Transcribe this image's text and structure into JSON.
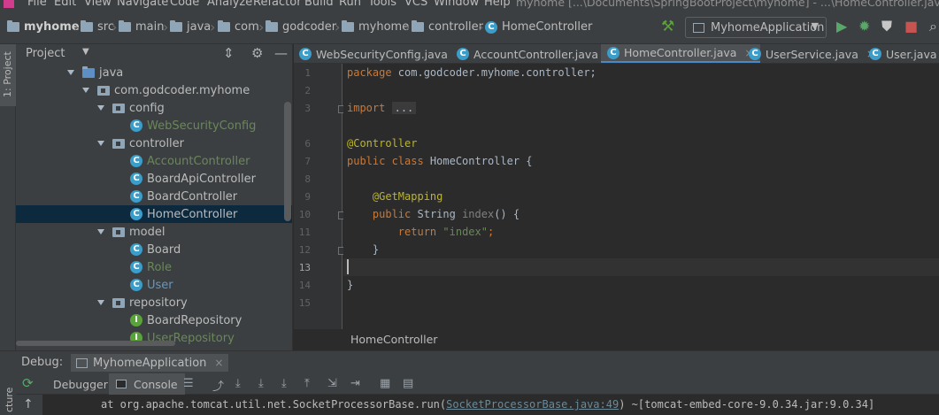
{
  "menubar": {
    "items": [
      "File",
      "Edit",
      "View",
      "Navigate",
      "Code",
      "Analyze",
      "Refactor",
      "Build",
      "Run",
      "Tools",
      "VCS",
      "Window",
      "Help"
    ],
    "window_title": "myhome [...\\Documents\\SpringBootProject\\myhome] - ...\\HomeController.java"
  },
  "navbar": {
    "breadcrumbs": [
      "myhome",
      "src",
      "main",
      "java",
      "com",
      "godcoder",
      "myhome",
      "controller",
      "HomeController"
    ],
    "run_config": "MyhomeApplication",
    "icons": [
      "hammer-icon",
      "run-icon",
      "debug-icon",
      "coverage-icon",
      "stop-icon"
    ]
  },
  "left_stripe": {
    "project_tab": "1: Project",
    "structure_tab": "cture"
  },
  "project": {
    "title": "Project",
    "tree": [
      {
        "label": "java",
        "kind": "folder"
      },
      {
        "label": "com.godcoder.myhome",
        "kind": "package"
      },
      {
        "label": "config",
        "kind": "package"
      },
      {
        "label": "WebSecurityConfig",
        "kind": "class",
        "color": "green"
      },
      {
        "label": "controller",
        "kind": "package"
      },
      {
        "label": "AccountController",
        "kind": "class",
        "color": "green"
      },
      {
        "label": "BoardApiController",
        "kind": "class"
      },
      {
        "label": "BoardController",
        "kind": "class"
      },
      {
        "label": "HomeController",
        "kind": "class",
        "selected": true
      },
      {
        "label": "model",
        "kind": "package"
      },
      {
        "label": "Board",
        "kind": "class"
      },
      {
        "label": "Role",
        "kind": "class",
        "color": "green"
      },
      {
        "label": "User",
        "kind": "class",
        "color": "blue"
      },
      {
        "label": "repository",
        "kind": "package"
      },
      {
        "label": "BoardRepository",
        "kind": "interface"
      },
      {
        "label": "UserRepository",
        "kind": "interface",
        "color": "green"
      }
    ]
  },
  "tabs": [
    {
      "label": "WebSecurityConfig.java"
    },
    {
      "label": "AccountController.java"
    },
    {
      "label": "HomeController.java",
      "active": true
    },
    {
      "label": "UserService.java"
    },
    {
      "label": "User.java"
    }
  ],
  "editor": {
    "line_numbers": [
      "1",
      "2",
      "3",
      "6",
      "7",
      "8",
      "9",
      "10",
      "11",
      "12",
      "13",
      "14",
      "15"
    ],
    "current_line": "13",
    "code": {
      "package_kw": "package",
      "package_name": " com.godcoder.myhome.controller;",
      "import_kw": "import",
      "import_fold": "...",
      "annotation_controller": "@Controller",
      "class_decl_kw": "public class",
      "class_name": " HomeController {",
      "annotation_getmapping": "@GetMapping",
      "method_kw": "public",
      "method_type": " String ",
      "method_name": "index",
      "method_rest": "() {",
      "return_kw": "return",
      "return_str": "\"index\"",
      "return_end": ";",
      "close_method": "}",
      "close_class": "}"
    },
    "breadcrumb": "HomeController"
  },
  "debug": {
    "title": "Debug:",
    "session": "MyhomeApplication",
    "subtabs": [
      "Debugger",
      "Console"
    ],
    "console_prefix": "at org.apache.tomcat.util.net.SocketProcessorBase.run(",
    "console_link": "SocketProcessorBase.java:49",
    "console_suffix": ") ~[tomcat-embed-core-9.0.34.jar:9.0.34]"
  }
}
